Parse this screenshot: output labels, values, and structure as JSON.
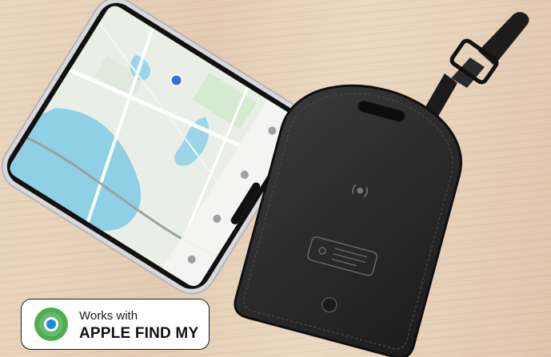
{
  "photo": {
    "subject": "iPhone showing a map next to a black leather luggage tag with strap",
    "colors": {
      "wood": "#e3ccb3",
      "tag": "#262626",
      "map_water": "#8fd0e4",
      "map_land": "#e9efe6"
    }
  },
  "badge": {
    "line1": "Works with",
    "line2": "APPLE FIND MY",
    "icon": "find-my-icon",
    "colors": {
      "ring": "#4caf50",
      "center": "#1e88e5",
      "border": "#1a1a1a"
    }
  }
}
